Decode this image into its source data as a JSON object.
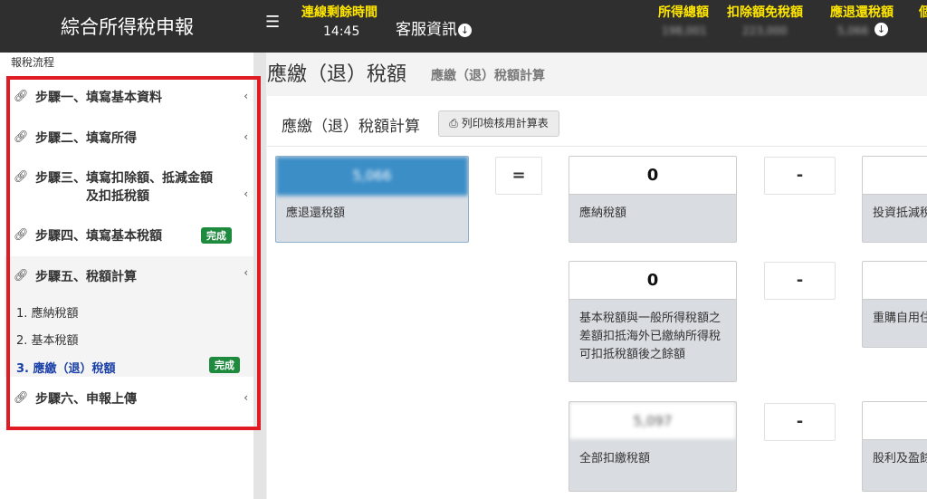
{
  "header": {
    "app_title": "綜合所得稅申報",
    "menu_icon": "hamburger-icon",
    "session_label": "連線剩餘時間",
    "session_time": "14:45",
    "service_label": "客服資訊",
    "stats": [
      {
        "label": "所得總額",
        "value": "198,001"
      },
      {
        "label": "扣除額免稅額",
        "value": "223,000"
      },
      {
        "label": "應退還稅額",
        "value": "5,066"
      }
    ],
    "edge_label": "個",
    "accent_color": "#ffe600"
  },
  "sidebar": {
    "heading": "報稅流程",
    "steps": [
      {
        "label": "步驟一、填寫基本資料"
      },
      {
        "label": "步驟二、填寫所得"
      },
      {
        "label_line1": "步驟三、填寫扣除額、抵減金額",
        "label_line2": "及扣抵稅額"
      },
      {
        "label": "步驟四、填寫基本稅額",
        "badge": "完成"
      },
      {
        "label": "步驟五、稅額計算"
      },
      {
        "label": "步驟六、申報上傳"
      }
    ],
    "sub_items": [
      {
        "label": "1. 應納稅額"
      },
      {
        "label": "2. 基本稅額"
      },
      {
        "label": "3. 應繳（退）稅額",
        "badge": "完成"
      }
    ]
  },
  "main": {
    "title": "應繳（退）稅額",
    "subtitle": "應繳（退）稅額計算",
    "panel_title": "應繳（退）稅額計算",
    "print_button": "列印檢核用計算表",
    "result_card": {
      "value": "5,066",
      "desc": "應退還稅額"
    },
    "equals": "=",
    "minus": "-",
    "cards": [
      {
        "value": "0",
        "desc": "應納稅額"
      },
      {
        "value": "0",
        "desc": "基本稅額與一般所得稅額之差額扣抵海外已繳納所得稅可扣抵稅額後之餘額"
      },
      {
        "value": "5,097",
        "desc": "全部扣繳稅額"
      }
    ],
    "right_cards": [
      {
        "desc": "投資抵減稅"
      },
      {
        "desc": "重購自用住"
      },
      {
        "desc": "股利及盈餘"
      }
    ]
  }
}
